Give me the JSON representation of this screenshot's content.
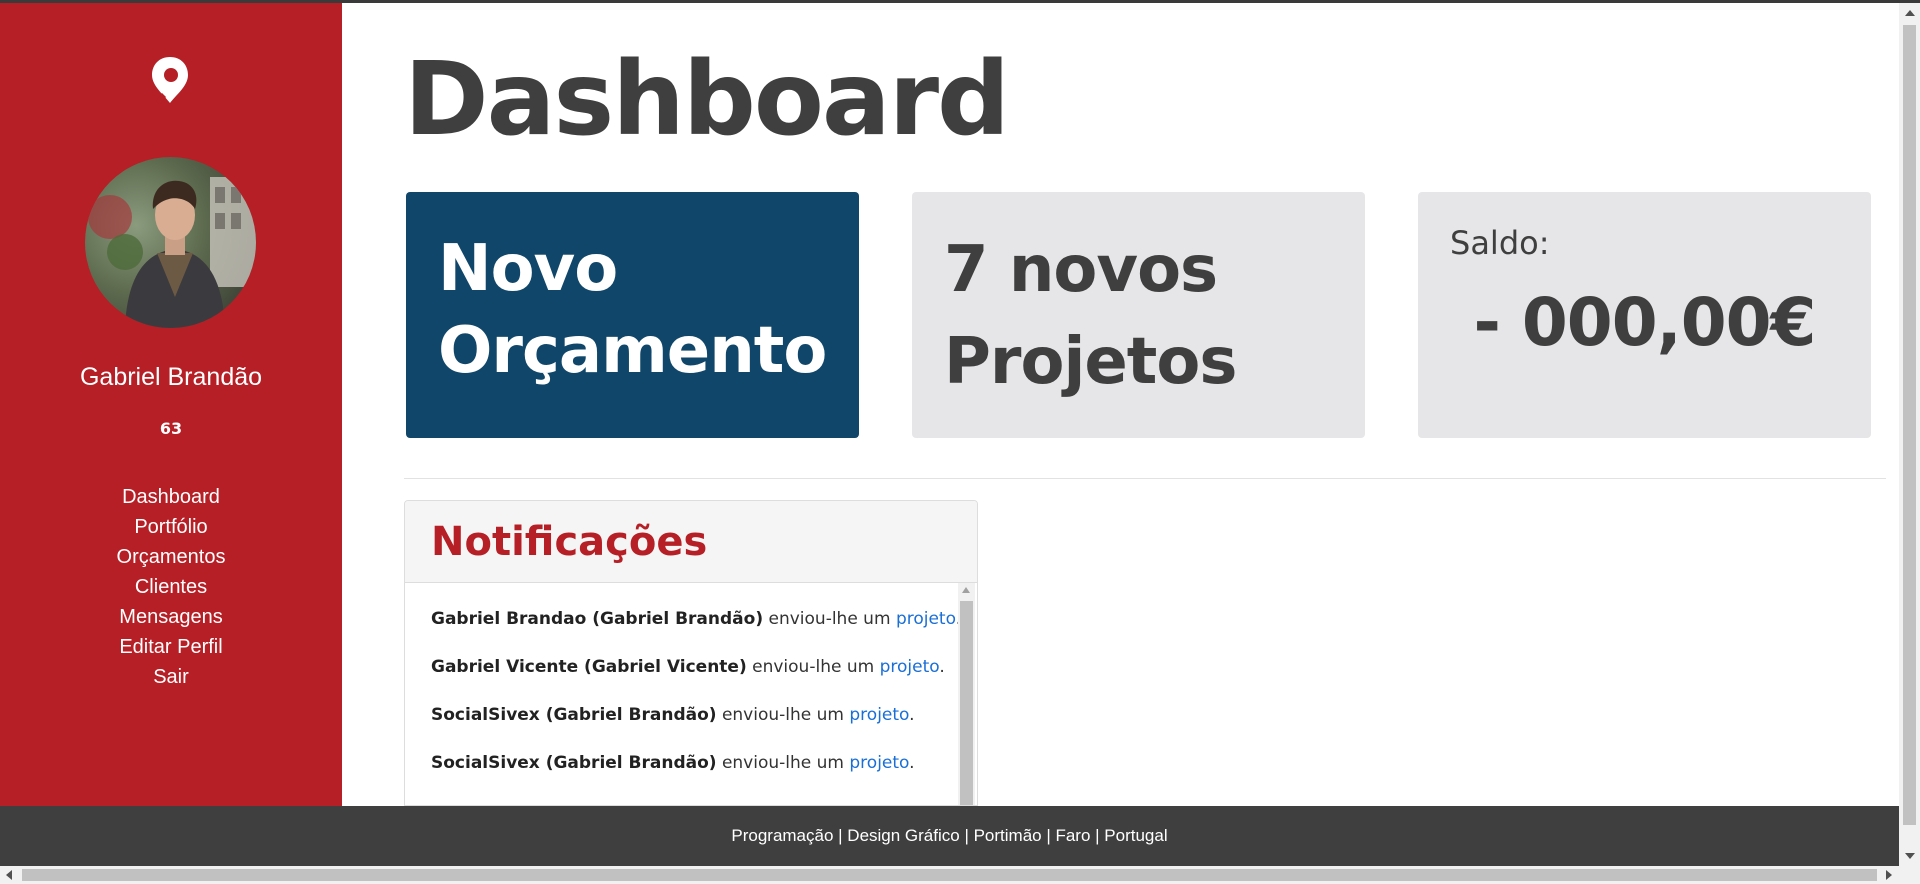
{
  "sidebar": {
    "logo_icon": "location-pin-icon",
    "user": {
      "name": "Gabriel Brandão",
      "count": "63"
    },
    "nav": [
      "Dashboard",
      "Portfólio",
      "Orçamentos",
      "Clientes",
      "Mensagens",
      "Editar Perfil",
      "Sair"
    ],
    "bg_color": "#b51f25"
  },
  "main": {
    "title": "Dashboard",
    "cards": {
      "novo": {
        "line1": "Novo",
        "line2": "Orçamento",
        "color": "#0f4669"
      },
      "projetos": {
        "line1": "7 novos",
        "line2": "Projetos"
      },
      "saldo": {
        "label": "Saldo:",
        "value": "- 000,00€"
      }
    },
    "notifications": {
      "title": "Notificações",
      "items": [
        {
          "sender": "Gabriel Brandao (Gabriel Brandão)",
          "text": " enviou-lhe um ",
          "link": "projeto",
          "end": "."
        },
        {
          "sender": "Gabriel Vicente (Gabriel Vicente)",
          "text": " enviou-lhe um ",
          "link": "projeto",
          "end": "."
        },
        {
          "sender": "SocialSivex (Gabriel Brandão)",
          "text": " enviou-lhe um ",
          "link": "projeto",
          "end": "."
        },
        {
          "sender": "SocialSivex (Gabriel Brandão)",
          "text": " enviou-lhe um ",
          "link": "projeto",
          "end": "."
        }
      ]
    }
  },
  "footer": {
    "text": "Programação | Design Gráfico | Portimão | Faro | Portugal"
  }
}
